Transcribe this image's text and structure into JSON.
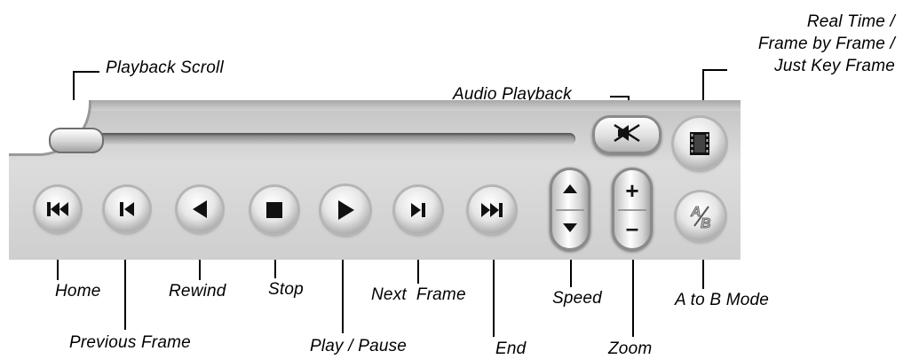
{
  "callouts": {
    "playback_scroll": "Playback Scroll",
    "audio_playback": "Audio Playback",
    "real_time_line1": "Real Time /",
    "real_time_line2": "Frame by Frame /",
    "real_time_line3": "Just Key Frame",
    "home": "Home",
    "previous_frame": "Previous Frame",
    "rewind": "Rewind",
    "stop": "Stop",
    "play_pause": "Play / Pause",
    "next_frame": "Next  Frame",
    "end": "End",
    "speed": "Speed",
    "zoom": "Zoom",
    "a_to_b": "A to B Mode"
  },
  "controls": {
    "zoom_plus": "+",
    "zoom_minus": "–"
  },
  "icons": {
    "home": "skip-to-start-icon",
    "previous_frame": "previous-frame-icon",
    "rewind": "rewind-icon",
    "stop": "stop-icon",
    "play": "play-icon",
    "next_frame": "next-frame-icon",
    "end": "skip-to-end-icon",
    "audio": "speaker-muted-icon",
    "frame_mode": "film-frame-icon",
    "ab_mode": "ab-icon"
  },
  "playback_position": 0.0
}
